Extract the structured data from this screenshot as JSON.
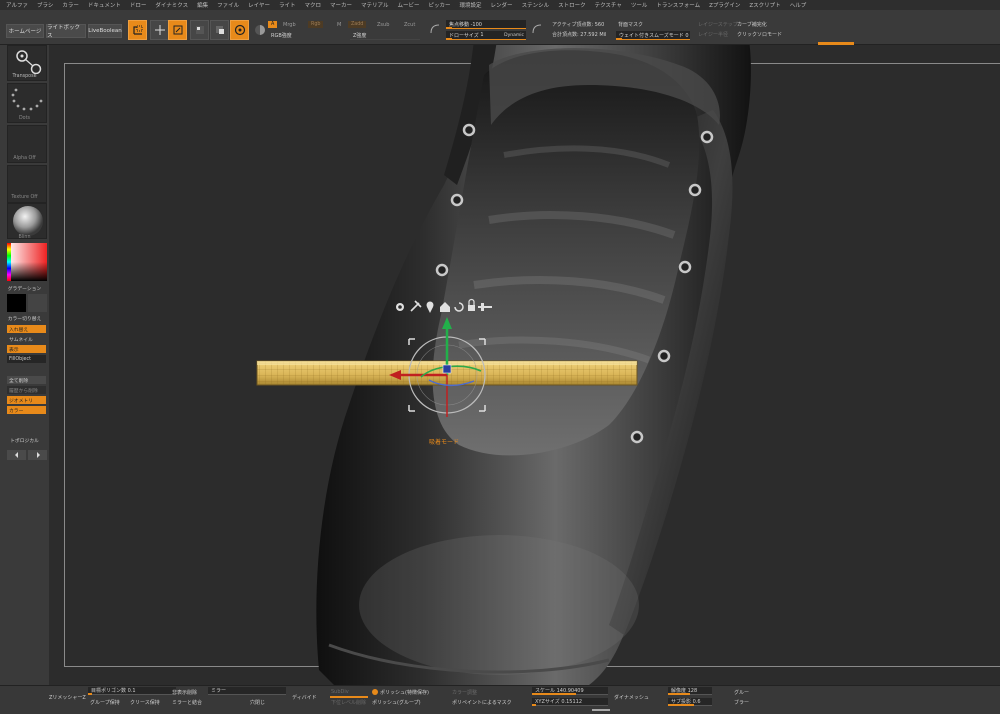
{
  "menubar": [
    "アルファ",
    "ブラシ",
    "カラー",
    "ドキュメント",
    "ドロー",
    "ダイナミクス",
    "編集",
    "ファイル",
    "レイヤー",
    "ライト",
    "マクロ",
    "マーカー",
    "マテリアル",
    "ムービー",
    "ピッカー",
    "環境設定",
    "レンダー",
    "ステンシル",
    "ストローク",
    "テクスチャ",
    "ツール",
    "トランスフォーム",
    "Zプラグイン",
    "Zスクリプト",
    "ヘルプ"
  ],
  "shelf": {
    "home": "ホームページ",
    "lightbox": "ライトボックス",
    "liveboolean": "LiveBoolean",
    "tool_edit": "Edit",
    "tool_draw": "Draw",
    "mrgb": {
      "a": "A",
      "rgb": "Mrgb",
      "rgb2": "Rgb",
      "m": "M",
      "zadd": "Zadd",
      "zsub": "Zsub",
      "zcut": "Zcut"
    },
    "rgb_intensity": "RGB強度",
    "z_intensity": "Z強度",
    "focal_shift": "焦点移動 -100",
    "draw_size": "ドローサイズ",
    "draw_size_value": "1",
    "dynamic": "Dynamic",
    "active_points": "アクティブ頂点数: 560",
    "total_points": "合計頂点数: 27.592 Mil",
    "backface_mask": "背面マスク",
    "weighted_smooth": "ウェイト付きスムーズモード 0",
    "lazy_mouse": "レイジーステップ",
    "curve_snap": "カーブ補完化",
    "lazy_radius": "レイジー半径",
    "click_solo": "クリックソロモード"
  },
  "left_tray": {
    "transpose": "Transpose",
    "dots": "Dots",
    "alpha": "Alpha Off",
    "texture": "Texture Off",
    "material": "Blinn",
    "gradient": "グラデーション",
    "color_switch": "カラー切り替え",
    "btn1": "入れ替え",
    "thumbnail": "サムネイル",
    "btn2": "表示",
    "fillobject": "FillObject",
    "fill_all": "全て削除",
    "fill_apply": "履歴から削除",
    "geometry": "ジオメトリ",
    "color": "カラー",
    "topological": "トポロジカル"
  },
  "gizmo": {
    "label": "吸着モード"
  },
  "bottom": {
    "zremesher": "ZリメッシャーZ",
    "target_poly": "目標ポリゴン数",
    "target_poly_value": "0.1",
    "group_keep": "グループ保持",
    "crease_keep": "クリース保持",
    "delete_hidden": "非表示削除",
    "mirror": "ミラー",
    "mirror_weld": "ミラーと結合",
    "close_holes": "穴閉じ",
    "divide": "ディバイド",
    "subdiv": "SubDiv",
    "lower_level_delete": "下位レベル削除",
    "polish_features": "ポリッシュ(特徴保存)",
    "polish_groups": "ポリッシュ(グループ)",
    "color_adjust": "カラー調整",
    "polypaint_mask": "ポリペイントによるマスク",
    "scale": "スケール",
    "scale_value": "140.90409",
    "xyz_size": "XYZサイズ",
    "xyz_size_value": "0.15112",
    "dynamesh": "ダイナメッシュ",
    "resolution": "解像度",
    "resolution_value": "128",
    "subproject": "サブ投影",
    "subproject_value": "0.6",
    "group": "グルー",
    "blur": "ブラー"
  },
  "colors": {
    "accent": "#e88a1a",
    "bg": "#2c2c2c",
    "panel": "#3a3a3a"
  }
}
